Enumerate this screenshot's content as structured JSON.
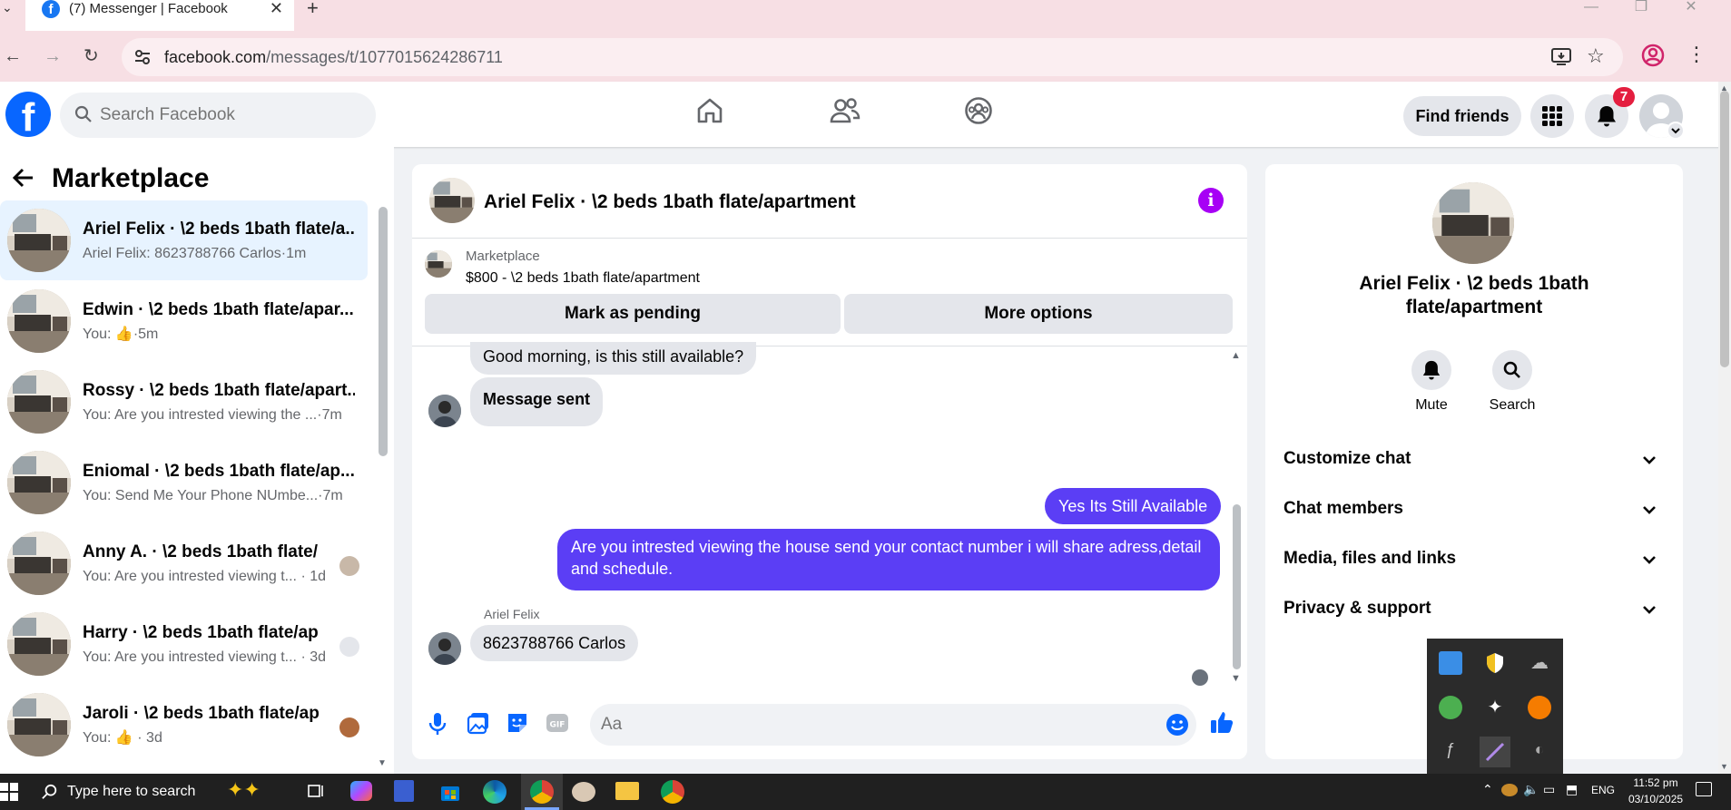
{
  "browser": {
    "tab_title": "(7) Messenger | Facebook",
    "url_host": "facebook.com",
    "url_path": "/messages/t/1077015624286711"
  },
  "header": {
    "search_placeholder": "Search Facebook",
    "find_friends": "Find friends",
    "notification_count": "7"
  },
  "sidebar": {
    "title": "Marketplace",
    "conversations": [
      {
        "name": "Ariel Felix · \\2 beds 1bath flate/a...",
        "preview": "Ariel Felix: 8623788766 Carlos",
        "time": "1m"
      },
      {
        "name": "Edwin · \\2 beds 1bath flate/apar...",
        "preview": "You:",
        "time": "5m"
      },
      {
        "name": "Rossy · \\2 beds 1bath flate/apart...",
        "preview": "You: Are you intrested viewing the ...",
        "time": "7m"
      },
      {
        "name": "Eniomal · \\2 beds 1bath flate/ap...",
        "preview": "You: Send Me Your Phone NUmbe...",
        "time": "7m"
      },
      {
        "name": "Anny A. · \\2 beds 1bath flate/...",
        "preview": "You: Are you intrested viewing t...",
        "time": "1d"
      },
      {
        "name": "Harry · \\2 beds 1bath flate/ap...",
        "preview": "You: Are you intrested viewing t...",
        "time": "3d"
      },
      {
        "name": "Jaroli · \\2 beds 1bath flate/ap...",
        "preview": "You:",
        "time": "3d"
      }
    ]
  },
  "chat": {
    "title": "Ariel Felix · \\2 beds 1bath flate/apartment",
    "marketplace_label": "Marketplace",
    "listing": "$800 - \\2 beds 1bath flate/apartment",
    "mark_pending": "Mark as pending",
    "more_options": "More options",
    "messages": {
      "in1": "Good morning, is this still available?",
      "in2": "Message sent",
      "out1": "Yes Its Still Available",
      "out2": "Are you intrested viewing the house send your contact number i will share adress,detail and schedule.",
      "sender": "Ariel Felix",
      "in3": "8623788766 Carlos"
    },
    "composer_placeholder": "Aa"
  },
  "details": {
    "name": "Ariel Felix · \\2 beds 1bath flate/apartment",
    "mute": "Mute",
    "search": "Search",
    "sections": [
      "Customize chat",
      "Chat members",
      "Media, files and links",
      "Privacy & support"
    ]
  },
  "taskbar": {
    "search_placeholder": "Type here to search",
    "language": "ENG",
    "time": "11:52 pm",
    "date": "03/10/2025"
  },
  "colors": {
    "facebook_blue": "#0866ff",
    "outgoing_bubble": "#5b3ef5",
    "info_purple": "#a700f5",
    "badge_red": "#e41e3f"
  }
}
